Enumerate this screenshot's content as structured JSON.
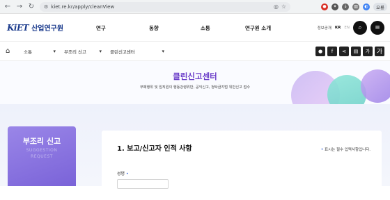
{
  "browser": {
    "url": "kiet.re.kr/apply/cleanView",
    "profile_label": "오류"
  },
  "site": {
    "logo_mark": "KiET",
    "logo_name": "산업연구원",
    "nav": [
      "연구",
      "동향",
      "소통",
      "연구원 소개"
    ],
    "util_link": "정보공개",
    "lang_active": "KR",
    "lang_inactive": "EN"
  },
  "breadcrumb": {
    "items": [
      "소통",
      "부조리 신고",
      "클린신고센터"
    ]
  },
  "quick_buttons": [
    "가",
    "가"
  ],
  "hero": {
    "title": "클린신고센터",
    "subtitle": "부패행위 및 임직원의 행동강령위반, 공익신고, 청탁금지법 위반신고 접수"
  },
  "sidebar": {
    "title": "부조리 신고",
    "en_line1": "SUGGESTION",
    "en_line2": "REQUEST"
  },
  "form": {
    "section_title": "1. 보고/신고자 인적 사항",
    "required_note": "표시는 필수 입력사항입니다.",
    "required_mark": "•",
    "name_label": "성명",
    "name_value": ""
  }
}
